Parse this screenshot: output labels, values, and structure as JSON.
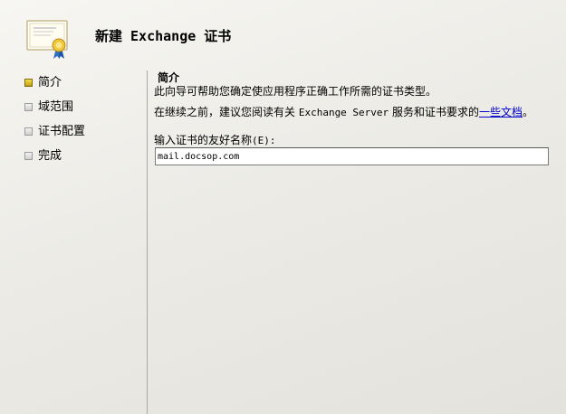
{
  "wizard": {
    "title": "新建 Exchange 证书"
  },
  "steps": [
    {
      "label": "简介",
      "active": true
    },
    {
      "label": "域范围",
      "active": false
    },
    {
      "label": "证书配置",
      "active": false
    },
    {
      "label": "完成",
      "active": false
    }
  ],
  "intro": {
    "heading": "简介",
    "description": "此向导可帮助您确定使应用程序正确工作所需的证书类型。",
    "recommend_prefix": "在继续之前，建议您阅读有关 ",
    "recommend_product": "Exchange Server",
    "recommend_middle": " 服务和证书要求的",
    "recommend_link": "一些文档",
    "recommend_suffix": "。"
  },
  "friendly_name": {
    "label_prefix": "输入证书的友好名称",
    "label_suffix": "(E):",
    "value": "mail.docsop.com"
  },
  "icons": {
    "header": "certificate-icon",
    "step_bullet": "square-bullet-icon"
  },
  "colors": {
    "active_step": "#e6c21f",
    "link": "#0000c8",
    "divider": "#a9a8a4"
  }
}
